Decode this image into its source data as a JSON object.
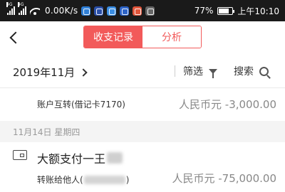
{
  "status_bar": {
    "signal1_tag": "4G",
    "signal2_tag": "4G",
    "network_speed": "0.00K/s",
    "battery_percent": "77%",
    "time": "上午10:10",
    "battery_level": 0.77
  },
  "nav": {
    "tabs": [
      {
        "label": "收支记录",
        "active": true
      },
      {
        "label": "分析",
        "active": false
      }
    ]
  },
  "filter_bar": {
    "month": "2019年11月",
    "filter_label": "筛选",
    "search_label": "搜索"
  },
  "transactions": {
    "top_row": {
      "description": "账户互转(借记卡7170)",
      "amount": "人民币元 -3,000.00"
    },
    "date_header": "11月14日  星期四",
    "row": {
      "title": "大额支付一王",
      "subtitle_prefix": "转账给他人(",
      "subtitle_suffix": ")",
      "amount": "人民币元 -75,000.00"
    }
  },
  "colors": {
    "accent": "#f25a5a",
    "status_bar": "#1a1a1a",
    "amount_text": "#888888",
    "date_header_bg": "#f4f4f4"
  }
}
